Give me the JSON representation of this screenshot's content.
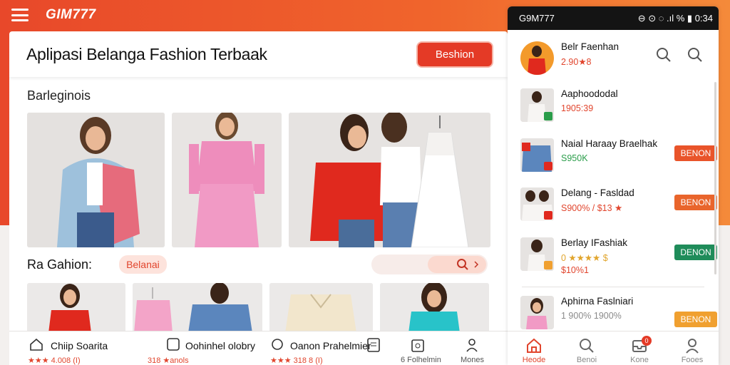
{
  "topbar": {
    "logo": "GIM777"
  },
  "header": {
    "title": "Aplipasi Belanga Fashion Terbaak",
    "button": "Beshion"
  },
  "sections": {
    "gallery_title": "Barleginois",
    "fashion_title": "Ra Gahion:",
    "chip": "Belanai"
  },
  "bottom_bar": [
    {
      "label": "Chiip Soarita",
      "sub": "★★★ 4.008 (I)",
      "icon": "home-icon"
    },
    {
      "label": "Oohinhel olobry",
      "sub": "318 ★anols",
      "icon": "square-icon"
    },
    {
      "label": "Oanon Prahelmier",
      "sub": "★★★ 318 8 (I)",
      "icon": "search-icon"
    },
    {
      "label": "",
      "sub": "",
      "icon": "list-icon"
    },
    {
      "label": "",
      "sub": "6 Folhelmin",
      "icon": "bag-icon"
    },
    {
      "label": "",
      "sub": "Mones",
      "icon": "user-icon"
    }
  ],
  "phone": {
    "status_left": "G9M777",
    "status_right": "⊖ ⊙ ◌  .ıl %  ▮ 0:34",
    "items": [
      {
        "name": "Belr Faenhan",
        "price": "2.90★8",
        "price_color": "#e1452d",
        "button": "",
        "button_color": ""
      },
      {
        "name": "Aaphoododal",
        "price": "1905:39",
        "price_color": "#e1452d",
        "button": "",
        "button_color": ""
      },
      {
        "name": "Naial Haraay Braelhak",
        "price": "S950K",
        "price_color": "#2a9d4a",
        "button": "BENON",
        "button_color": "#e9542a"
      },
      {
        "name": "Delang - Fasldad",
        "price": "S900% / $13 ★",
        "price_color": "#e1452d",
        "button": "BENON",
        "button_color": "#e9652c"
      },
      {
        "name": "Berlay IFashiak",
        "price": "0 ★★★★ $",
        "price_sub": "$10%1",
        "price_color": "#e1a52d",
        "button": "DENON",
        "button_color": "#1f8c5a"
      },
      {
        "name": "Aphirna Faslniari",
        "price": "1 900% 1900%",
        "price_color": "#8a8a8a",
        "button": "BENON",
        "button_color": "#f0a030"
      }
    ],
    "nav": [
      {
        "label": "Heode",
        "icon": "home-icon",
        "active": true
      },
      {
        "label": "Benoi",
        "icon": "search-icon",
        "active": false
      },
      {
        "label": "Kone",
        "icon": "inbox-icon",
        "active": false,
        "badge": "0"
      },
      {
        "label": "Fooes",
        "icon": "user-icon",
        "active": false
      }
    ]
  },
  "colors": {
    "brand": "#e8482a",
    "accent": "#f48a3a",
    "dark": "#141414"
  }
}
